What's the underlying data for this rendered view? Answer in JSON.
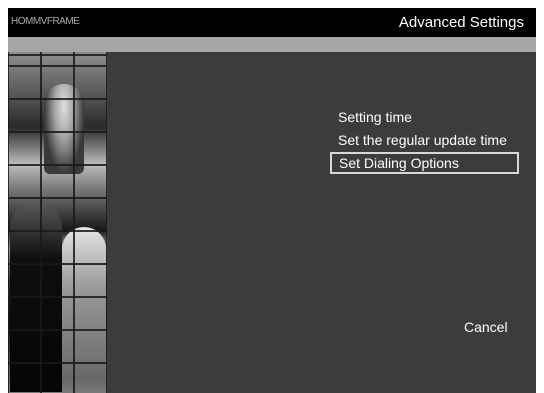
{
  "header": {
    "logo_text": "HOMMVFRAME",
    "title": "Advanced Settings"
  },
  "menu": {
    "items": [
      {
        "label": "Setting time",
        "selected": false
      },
      {
        "label": "Set the regular update time",
        "selected": false
      },
      {
        "label": "Set Dialing Options",
        "selected": true
      }
    ]
  },
  "footer": {
    "cancel_label": "Cancel"
  },
  "colors": {
    "background": "#3c3c3c",
    "header": "#000000",
    "bar": "#a6a6a6",
    "selection_border": "#d8d8d8"
  }
}
